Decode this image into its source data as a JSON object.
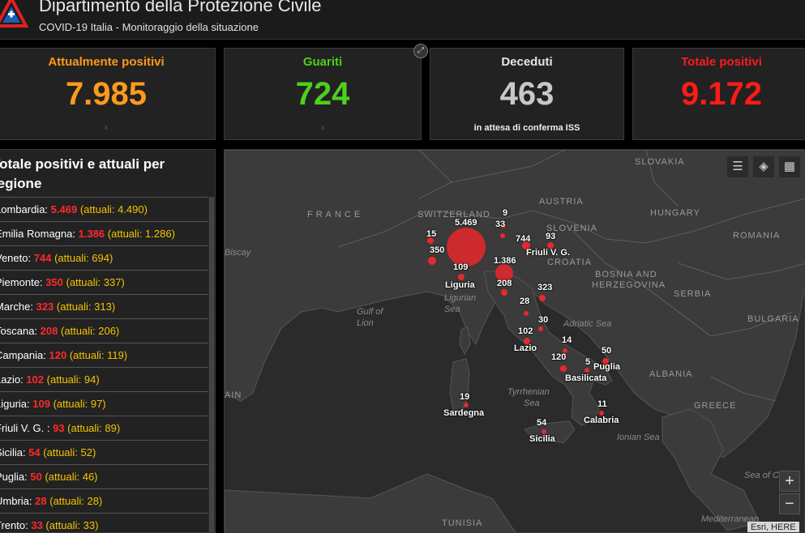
{
  "header": {
    "title": "Dipartimento della Protezione Civile",
    "subtitle": "COVID-19 Italia - Monitoraggio della situazione"
  },
  "cards": [
    {
      "label": "Attualmente positivi",
      "value": "7.985",
      "color": "#ff9a1a",
      "note": "x"
    },
    {
      "label": "Guariti",
      "value": "724",
      "color": "#4cd11c",
      "note": "x"
    },
    {
      "label": "Deceduti",
      "value": "463",
      "color": "#c8c8c8",
      "note": "in attesa di conferma ISS"
    },
    {
      "label": "Totale positivi",
      "value": "9.172",
      "color": "#ff1a1a",
      "note": ""
    }
  ],
  "regions_panel": {
    "title": "Totale positivi e attuali per regione",
    "items": [
      {
        "name": "Lombardia:",
        "total": "5.469",
        "current": "(attuali: 4.490)"
      },
      {
        "name": "Emilia Romagna:",
        "total": "1.386",
        "current": "(attuali: 1.286)"
      },
      {
        "name": "Veneto:",
        "total": "744",
        "current": "(attuali: 694)"
      },
      {
        "name": "Piemonte:",
        "total": "350",
        "current": "(attuali: 337)"
      },
      {
        "name": "Marche:",
        "total": "323",
        "current": "(attuali: 313)"
      },
      {
        "name": "Toscana:",
        "total": "208",
        "current": "(attuali: 206)"
      },
      {
        "name": "Campania:",
        "total": "120",
        "current": "(attuali: 119)"
      },
      {
        "name": "Lazio:",
        "total": "102",
        "current": "(attuali: 94)"
      },
      {
        "name": "Liguria:",
        "total": "109",
        "current": "(attuali: 97)"
      },
      {
        "name": "Friuli V. G. :",
        "total": "93",
        "current": "(attuali: 89)"
      },
      {
        "name": "Sicilia:",
        "total": "54",
        "current": "(attuali: 52)"
      },
      {
        "name": "Puglia:",
        "total": "50",
        "current": "(attuali: 46)"
      },
      {
        "name": "Umbria:",
        "total": "28",
        "current": "(attuali: 28)"
      },
      {
        "name": "Trento:",
        "total": "33",
        "current": "(attuali: 33)"
      }
    ]
  },
  "map": {
    "countries": [
      "FRANCE",
      "SWITZERLAND",
      "AUSTRIA",
      "SLOVENIA",
      "CROATIA",
      "HUNGARY",
      "ROMANIA",
      "SLOVAKIA",
      "BOSNIA AND",
      "HERZEGOVINA",
      "SERBIA",
      "BULGARIA",
      "ALBANIA",
      "GREECE",
      "TUNISIA",
      "AIN"
    ],
    "seas": [
      "Biscay",
      "Gulf of",
      "Lion",
      "Ligurian",
      "Sea",
      "Adriatic Sea",
      "Tyrrhenian",
      "Sea",
      "Ionian Sea",
      "Sea of C",
      "Mediterranean"
    ],
    "markers": [
      {
        "label": "5.469"
      },
      {
        "label": "9"
      },
      {
        "label": "33"
      },
      {
        "label": "15"
      },
      {
        "label": "744"
      },
      {
        "label": "93"
      },
      {
        "label": "350"
      },
      {
        "label": "Friuli V. G."
      },
      {
        "label": "109"
      },
      {
        "label": "1.386"
      },
      {
        "label": "Liguria"
      },
      {
        "label": "208"
      },
      {
        "label": "323"
      },
      {
        "label": "28"
      },
      {
        "label": "30"
      },
      {
        "label": "102"
      },
      {
        "label": "14"
      },
      {
        "label": "Lazio"
      },
      {
        "label": "50"
      },
      {
        "label": "120"
      },
      {
        "label": "5"
      },
      {
        "label": "Puglia"
      },
      {
        "label": "Basilicata"
      },
      {
        "label": "19"
      },
      {
        "label": "11"
      },
      {
        "label": "Sardegna"
      },
      {
        "label": "Calabria"
      },
      {
        "label": "54"
      },
      {
        "label": "Sicilia"
      }
    ],
    "zoom_in": "+",
    "zoom_out": "−",
    "attribution": "Esri, HERE",
    "colors": {
      "marker": "#e8282c",
      "land": "#3b3b3b",
      "sea": "#2b2b2b",
      "border": "#666666"
    }
  }
}
